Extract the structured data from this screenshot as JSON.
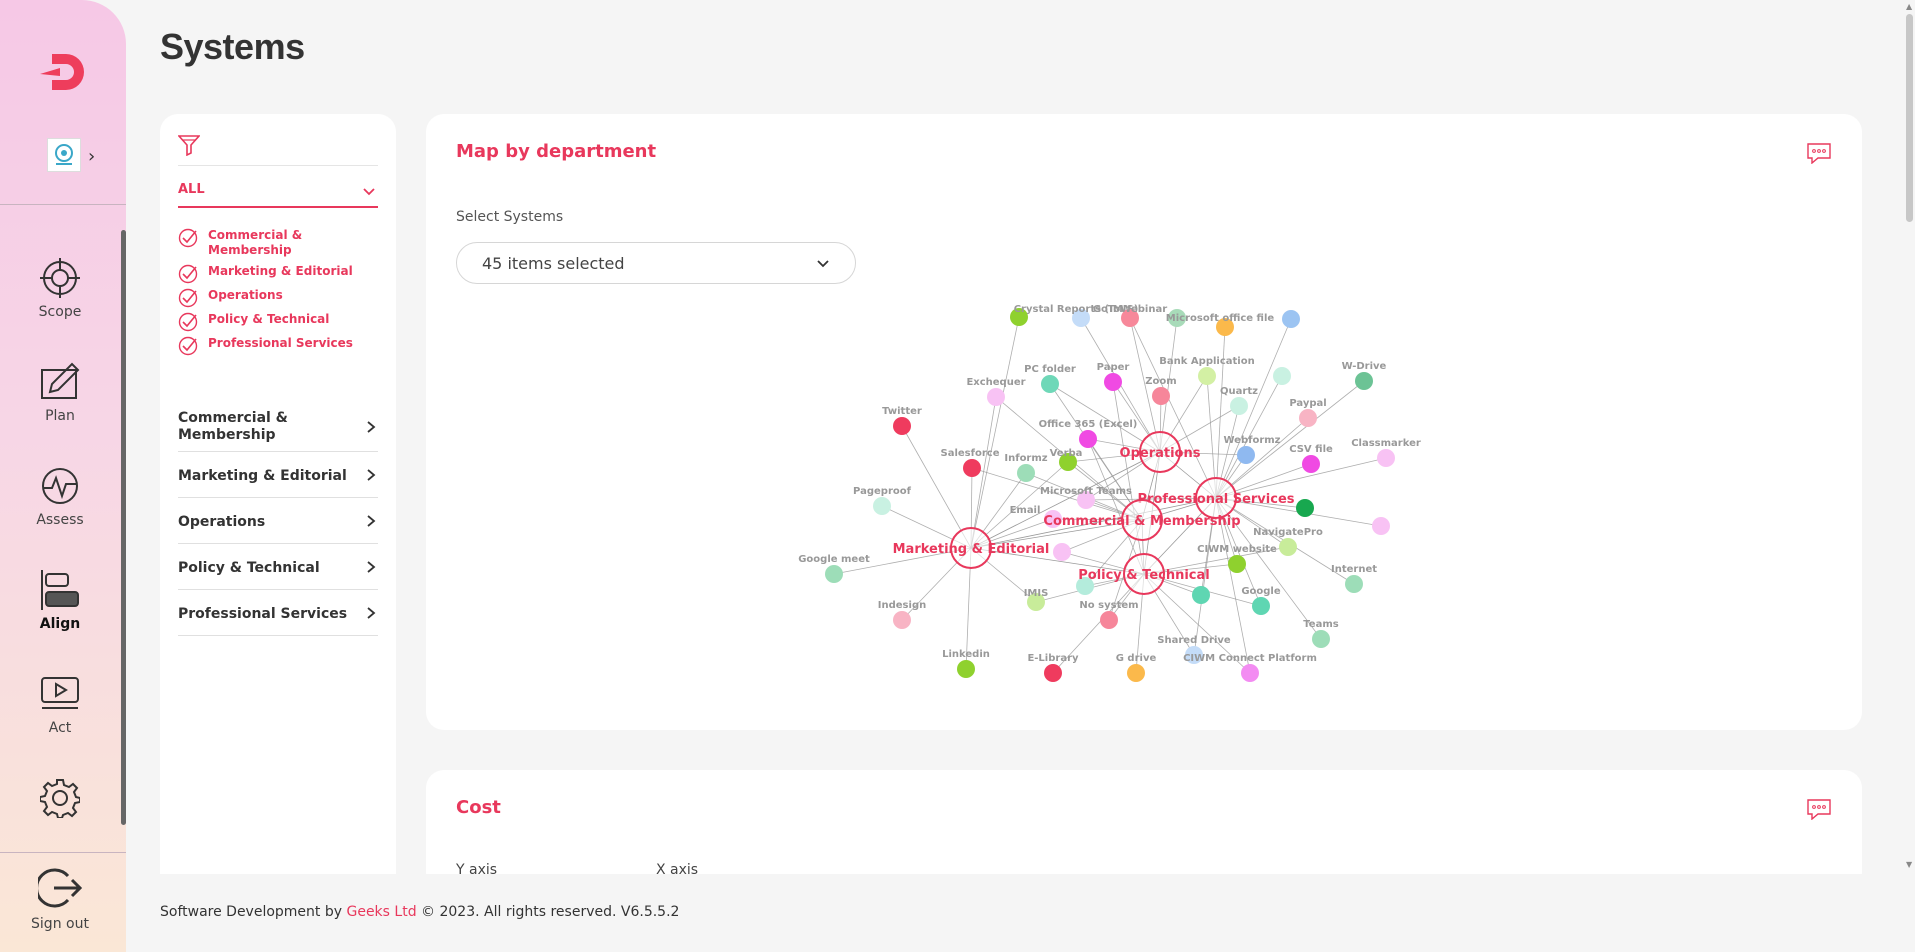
{
  "nav": {
    "items": [
      {
        "label": "Scope",
        "icon": "crosshair-icon"
      },
      {
        "label": "Plan",
        "icon": "pen-icon"
      },
      {
        "label": "Assess",
        "icon": "assess-icon"
      },
      {
        "label": "Align",
        "icon": "align-icon",
        "active": true
      },
      {
        "label": "Act",
        "icon": "play-icon"
      }
    ],
    "signout_label": "Sign out"
  },
  "page": {
    "title": "Systems"
  },
  "filters": {
    "all_label": "ALL",
    "checked": [
      "Commercial & Membership",
      "Marketing & Editorial",
      "Operations",
      "Policy & Technical",
      "Professional Services"
    ],
    "departments": [
      "Commercial & Membership",
      "Marketing & Editorial",
      "Operations",
      "Policy & Technical",
      "Professional Services"
    ]
  },
  "map_card": {
    "title": "Map by department",
    "select_label": "Select Systems",
    "select_value": "45 items selected"
  },
  "graph": {
    "hubs": [
      {
        "name": "Operations"
      },
      {
        "name": "Professional Services"
      },
      {
        "name": "Commercial & Membership"
      },
      {
        "name": "Marketing & Editorial"
      },
      {
        "name": "Policy & Technical"
      }
    ],
    "nodes": [
      {
        "name": "",
        "color": "#8fd12e"
      },
      {
        "name": "Crystal Reports (IMIS)",
        "color": "#c4dcf8"
      },
      {
        "name": "GoToWebinar",
        "color": "#f7889a"
      },
      {
        "name": "",
        "color": "#a8dbb9"
      },
      {
        "name": "Microsoft office file",
        "color": "#fbb94b"
      },
      {
        "name": "",
        "color": "#9cc4f2"
      },
      {
        "name": "PC folder",
        "color": "#6fd8b8"
      },
      {
        "name": "Paper",
        "color": "#f04ae3"
      },
      {
        "name": "Zoom",
        "color": "#f6869a"
      },
      {
        "name": "Bank Application",
        "color": "#d3f0a4"
      },
      {
        "name": "",
        "color": "#c9f1e2"
      },
      {
        "name": "W-Drive",
        "color": "#6cc395"
      },
      {
        "name": "Exchequer",
        "color": "#f8c2f4"
      },
      {
        "name": "Twitter",
        "color": "#ef3b5e"
      },
      {
        "name": "Quartz",
        "color": "#c9f1e2"
      },
      {
        "name": "Paypal",
        "color": "#f8b4c4"
      },
      {
        "name": "Office 365 (Excel)",
        "color": "#f04ae3"
      },
      {
        "name": "Verba",
        "color": "#8fd12e"
      },
      {
        "name": "Salesforce",
        "color": "#ef3b5e"
      },
      {
        "name": "Informz",
        "color": "#9dddb8"
      },
      {
        "name": "Webformz",
        "color": "#8fb9f0"
      },
      {
        "name": "CSV file",
        "color": "#f04ae3"
      },
      {
        "name": "Classmarker",
        "color": "#f8c2f4"
      },
      {
        "name": "Pageproof",
        "color": "#c9f1e2"
      },
      {
        "name": "Microsoft Teams",
        "color": "#f8c2f4"
      },
      {
        "name": "Email",
        "color": "#f8c2f4"
      },
      {
        "name": "",
        "color": "#18a84f"
      },
      {
        "name": "",
        "color": "#f8c2f4"
      },
      {
        "name": "NavigatePro",
        "color": "#c8ec9a"
      },
      {
        "name": "Google meet",
        "color": "#9dddb8"
      },
      {
        "name": "CIWM website",
        "color": "#8fd12e"
      },
      {
        "name": "Internet",
        "color": "#9dddb8"
      },
      {
        "name": "",
        "color": "#f8c2f4"
      },
      {
        "name": "Indesign",
        "color": "#f8b4c4"
      },
      {
        "name": "IMIS",
        "color": "#c8ec9a"
      },
      {
        "name": "",
        "color": "#b4ecdc"
      },
      {
        "name": "No system",
        "color": "#f6869a"
      },
      {
        "name": "",
        "color": "#5fd6b2"
      },
      {
        "name": "Google",
        "color": "#5fd6b2"
      },
      {
        "name": "Teams",
        "color": "#9dddb8"
      },
      {
        "name": "Linkedin",
        "color": "#8fd12e"
      },
      {
        "name": "E-Library",
        "color": "#ef3b5e"
      },
      {
        "name": "G drive",
        "color": "#fbb94b"
      },
      {
        "name": "Shared Drive",
        "color": "#c4dcf8"
      },
      {
        "name": "CIWM Connect Platform",
        "color": "#f38cf2"
      }
    ]
  },
  "cost_card": {
    "title": "Cost",
    "y_axis_label": "Y axis",
    "x_axis_label": "X axis"
  },
  "footer": {
    "prefix": "Software Development by ",
    "company": "Geeks Ltd",
    "suffix": " © 2023. All rights reserved. V6.5.5.2"
  },
  "theme": {
    "accent": "#e8385c",
    "line": "#9a9a9a"
  }
}
